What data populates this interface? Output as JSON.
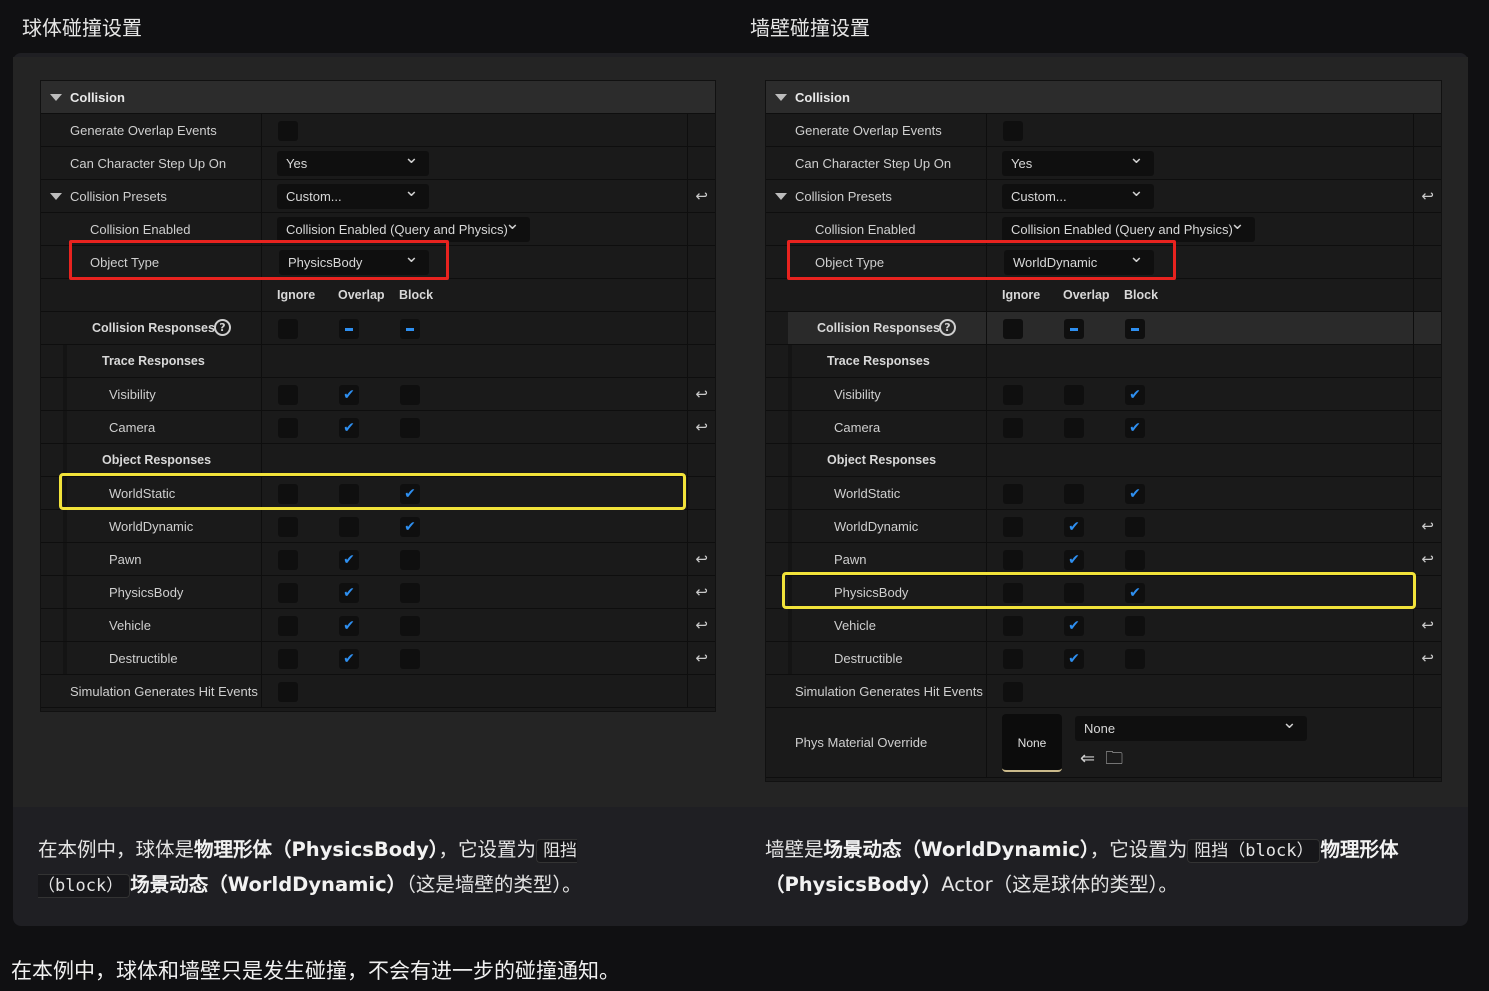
{
  "titles": {
    "left": "球体碰撞设置",
    "right": "墙壁碰撞设置"
  },
  "left_panel": {
    "category": "Collision",
    "generate_overlap": "Generate Overlap Events",
    "step_up_label": "Can Character Step Up On",
    "step_up_value": "Yes",
    "presets_label": "Collision Presets",
    "presets_value": "Custom...",
    "enabled_label": "Collision Enabled",
    "enabled_value": "Collision Enabled (Query and Physics)",
    "object_type_label": "Object Type",
    "object_type_value": "PhysicsBody",
    "col_ignore": "Ignore",
    "col_overlap": "Overlap",
    "col_block": "Block",
    "responses_label": "Collision Responses",
    "trace_label": "Trace Responses",
    "object_label": "Object Responses",
    "trace_rows": [
      {
        "label": "Visibility",
        "value": "Overlap",
        "reset": true
      },
      {
        "label": "Camera",
        "value": "Overlap",
        "reset": true
      }
    ],
    "object_rows": [
      {
        "label": "WorldStatic",
        "value": "Block",
        "reset": false
      },
      {
        "label": "WorldDynamic",
        "value": "Block",
        "reset": false
      },
      {
        "label": "Pawn",
        "value": "Overlap",
        "reset": true
      },
      {
        "label": "PhysicsBody",
        "value": "Overlap",
        "reset": true
      },
      {
        "label": "Vehicle",
        "value": "Overlap",
        "reset": true
      },
      {
        "label": "Destructible",
        "value": "Overlap",
        "reset": true
      }
    ],
    "sim_hit": "Simulation Generates Hit Events"
  },
  "right_panel": {
    "category": "Collision",
    "generate_overlap": "Generate Overlap Events",
    "step_up_label": "Can Character Step Up On",
    "step_up_value": "Yes",
    "presets_label": "Collision Presets",
    "presets_value": "Custom...",
    "enabled_label": "Collision Enabled",
    "enabled_value": "Collision Enabled (Query and Physics)",
    "object_type_label": "Object Type",
    "object_type_value": "WorldDynamic",
    "col_ignore": "Ignore",
    "col_overlap": "Overlap",
    "col_block": "Block",
    "responses_label": "Collision Responses",
    "trace_label": "Trace Responses",
    "object_label": "Object Responses",
    "trace_rows": [
      {
        "label": "Visibility",
        "value": "Block",
        "reset": false
      },
      {
        "label": "Camera",
        "value": "Block",
        "reset": false
      }
    ],
    "object_rows": [
      {
        "label": "WorldStatic",
        "value": "Block",
        "reset": false
      },
      {
        "label": "WorldDynamic",
        "value": "Overlap",
        "reset": true
      },
      {
        "label": "Pawn",
        "value": "Overlap",
        "reset": true
      },
      {
        "label": "PhysicsBody",
        "value": "Block",
        "reset": false
      },
      {
        "label": "Vehicle",
        "value": "Overlap",
        "reset": true
      },
      {
        "label": "Destructible",
        "value": "Overlap",
        "reset": true
      }
    ],
    "sim_hit": "Simulation Generates Hit Events",
    "phys_material_label": "Phys Material Override",
    "phys_material_thumb": "None",
    "phys_material_value": "None"
  },
  "captions": {
    "left_1": "在本例中，球体是",
    "left_bold_1": "物理形体（PhysicsBody）",
    "left_2": "，它设置为",
    "left_code": "阻挡（block）",
    "left_bold_2": "场景动态（WorldDynamic）",
    "left_3": "（这是墙壁的类型）。",
    "right_1": "墙壁是",
    "right_bold_1": "场景动态（WorldDynamic）",
    "right_2": "，它设置为",
    "right_code": "阻挡（block）",
    "right_bold_2": "物理形体（PhysicsBody）",
    "right_3": "Actor（这是球体的类型）。"
  },
  "footer": "在本例中，球体和墙壁只是发生碰撞，不会有进一步的碰撞通知。",
  "colors": {
    "check_blue": "#2e8ff0",
    "highlight_red": "#e8231f",
    "highlight_yellow": "#f2e33a"
  }
}
